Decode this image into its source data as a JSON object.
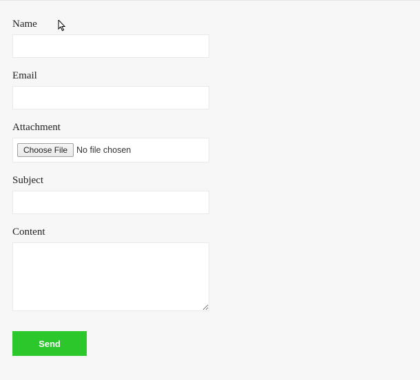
{
  "form": {
    "name": {
      "label": "Name",
      "value": ""
    },
    "email": {
      "label": "Email",
      "value": ""
    },
    "attachment": {
      "label": "Attachment",
      "button_label": "Choose File",
      "status_text": "No file chosen"
    },
    "subject": {
      "label": "Subject",
      "value": ""
    },
    "content": {
      "label": "Content",
      "value": ""
    },
    "submit_label": "Send"
  },
  "colors": {
    "accent": "#2bc72b",
    "background": "#f7f7f7",
    "input_border": "#e9e9e9"
  }
}
